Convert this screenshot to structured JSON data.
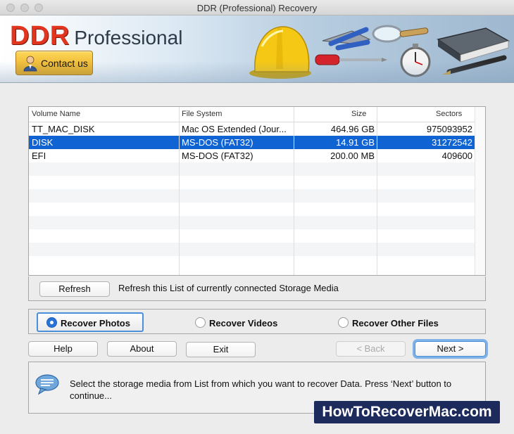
{
  "window": {
    "title": "DDR (Professional) Recovery"
  },
  "banner": {
    "logo_main": "DDR",
    "logo_sub": "Professional",
    "contact_label": "Contact us"
  },
  "table": {
    "headers": {
      "name": "Volume Name",
      "fs": "File System",
      "size": "Size",
      "sectors": "Sectors"
    },
    "rows": [
      {
        "name": "TT_MAC_DISK",
        "fs": "Mac OS Extended (Jour...",
        "size": "464.96  GB",
        "sectors": "975093952"
      },
      {
        "name": "DISK",
        "fs": "MS-DOS (FAT32)",
        "size": "14.91  GB",
        "sectors": "31272542"
      },
      {
        "name": "EFI",
        "fs": "MS-DOS (FAT32)",
        "size": "200.00  MB",
        "sectors": "409600"
      }
    ]
  },
  "refresh": {
    "button": "Refresh",
    "text": "Refresh this List of currently connected Storage Media"
  },
  "options": {
    "photos": "Recover Photos",
    "videos": "Recover Videos",
    "other": "Recover Other Files"
  },
  "buttons": {
    "help": "Help",
    "about": "About",
    "exit": "Exit",
    "back": "< Back",
    "next": "Next >"
  },
  "info": {
    "text": "Select the storage media from List from which you want to recover Data. Press ‘Next’ button to continue..."
  },
  "watermark": "HowToRecoverMac.com"
}
